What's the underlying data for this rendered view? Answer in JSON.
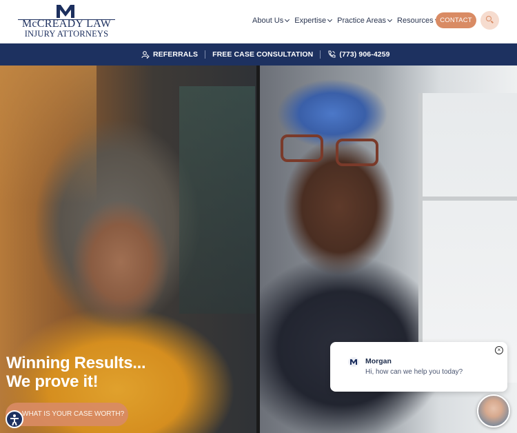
{
  "header": {
    "logo": {
      "line1": "McCREADY LAW",
      "line2": "INJURY ATTORNEYS"
    },
    "nav": [
      {
        "label": "About Us"
      },
      {
        "label": "Expertise"
      },
      {
        "label": "Practice Areas"
      },
      {
        "label": "Resources"
      }
    ],
    "contact_label": "CONTACT",
    "search_icon": "search-icon"
  },
  "topbar": {
    "referrals": "REFERRALS",
    "consultation": "FREE CASE CONSULTATION",
    "phone": "(773) 906-4259"
  },
  "hero": {
    "headline_line1": "Winning Results...",
    "headline_line2": "We prove it!",
    "cta_label": "WHAT IS YOUR CASE WORTH?"
  },
  "chat": {
    "agent_name": "Morgan",
    "message": "Hi, how can we help you today?"
  },
  "colors": {
    "navy": "#1d3160",
    "accent": "#d98b64"
  }
}
